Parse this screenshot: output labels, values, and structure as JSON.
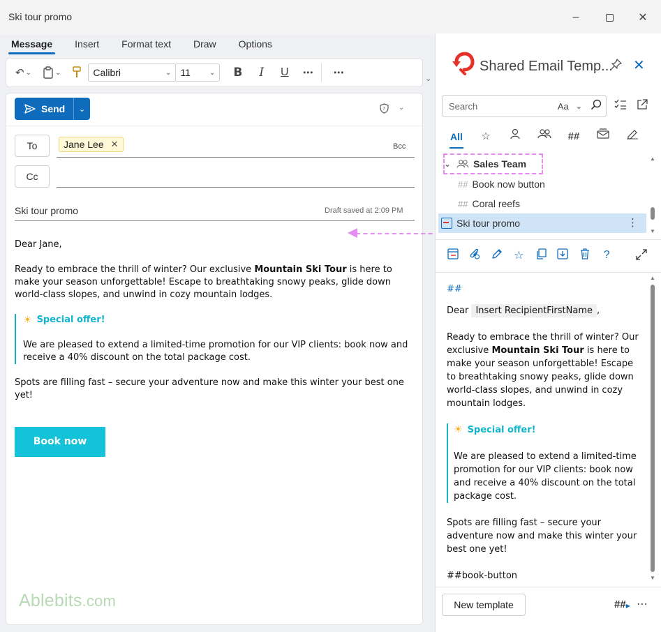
{
  "window": {
    "title": "Ski tour promo"
  },
  "ribbon": {
    "tabs": [
      {
        "label": "Message",
        "active": true
      },
      {
        "label": "Insert"
      },
      {
        "label": "Format text"
      },
      {
        "label": "Draw"
      },
      {
        "label": "Options"
      }
    ],
    "font_name": "Calibri",
    "font_size": "11"
  },
  "compose": {
    "send_label": "Send",
    "to_label": "To",
    "cc_label": "Cc",
    "bcc_label": "Bcc",
    "recipient": "Jane Lee",
    "subject": "Ski tour promo",
    "draft_status": "Draft saved at 2:09 PM",
    "body": {
      "greeting": "Dear Jane,",
      "para1_before": "Ready to embrace the thrill of winter? Our exclusive ",
      "para1_bold": "Mountain Ski Tour",
      "para1_after": " is here to make your season unforgettable! Escape to breathtaking snowy peaks, glide down world-class slopes, and unwind in cozy mountain lodges.",
      "offer_title": "Special offer!",
      "offer_text": "We are pleased to extend a limited-time promotion for our VIP clients: book now and receive a 40% discount on the total package cost.",
      "closing": "Spots are filling fast – secure your adventure now and make this winter your best one yet!",
      "button_label": "Book now"
    }
  },
  "watermark": {
    "brand": "Ablebits",
    "tld": ".com"
  },
  "pane": {
    "title": "Shared Email Temp...",
    "search_placeholder": "Search",
    "match_case": "Aa",
    "filter_all": "All",
    "tree": {
      "folder": "Sales Team",
      "items": [
        {
          "label": "Book now button",
          "type": "macro"
        },
        {
          "label": "Coral reefs",
          "type": "macro"
        },
        {
          "label": "Ski tour promo",
          "type": "template",
          "selected": true
        }
      ]
    },
    "preview": {
      "top_macro": "##",
      "dear": "Dear",
      "field": "Insert RecipientFirstName",
      "comma": ",",
      "para1_before": "Ready to embrace the thrill of winter? Our exclusive ",
      "para1_bold": "Mountain Ski Tour",
      "para1_after": " is here to make your season unforgettable! Escape to breathtaking snowy peaks, glide down world-class slopes, and unwind in cozy mountain lodges.",
      "offer_title": "Special offer!",
      "offer_text": "We are pleased to extend a limited-time promotion for our VIP clients: book now and receive a 40% discount on the total package cost.",
      "closing": "Spots are filling fast – secure your adventure now and make this winter your best one yet!",
      "macro_line": "##book-button"
    },
    "new_template_label": "New template",
    "bottom_hash": "##"
  },
  "colors": {
    "accent": "#0f6cbd",
    "cta": "#14c3d9",
    "offer": "#12b5cb",
    "highlight": "#e58cf0"
  }
}
